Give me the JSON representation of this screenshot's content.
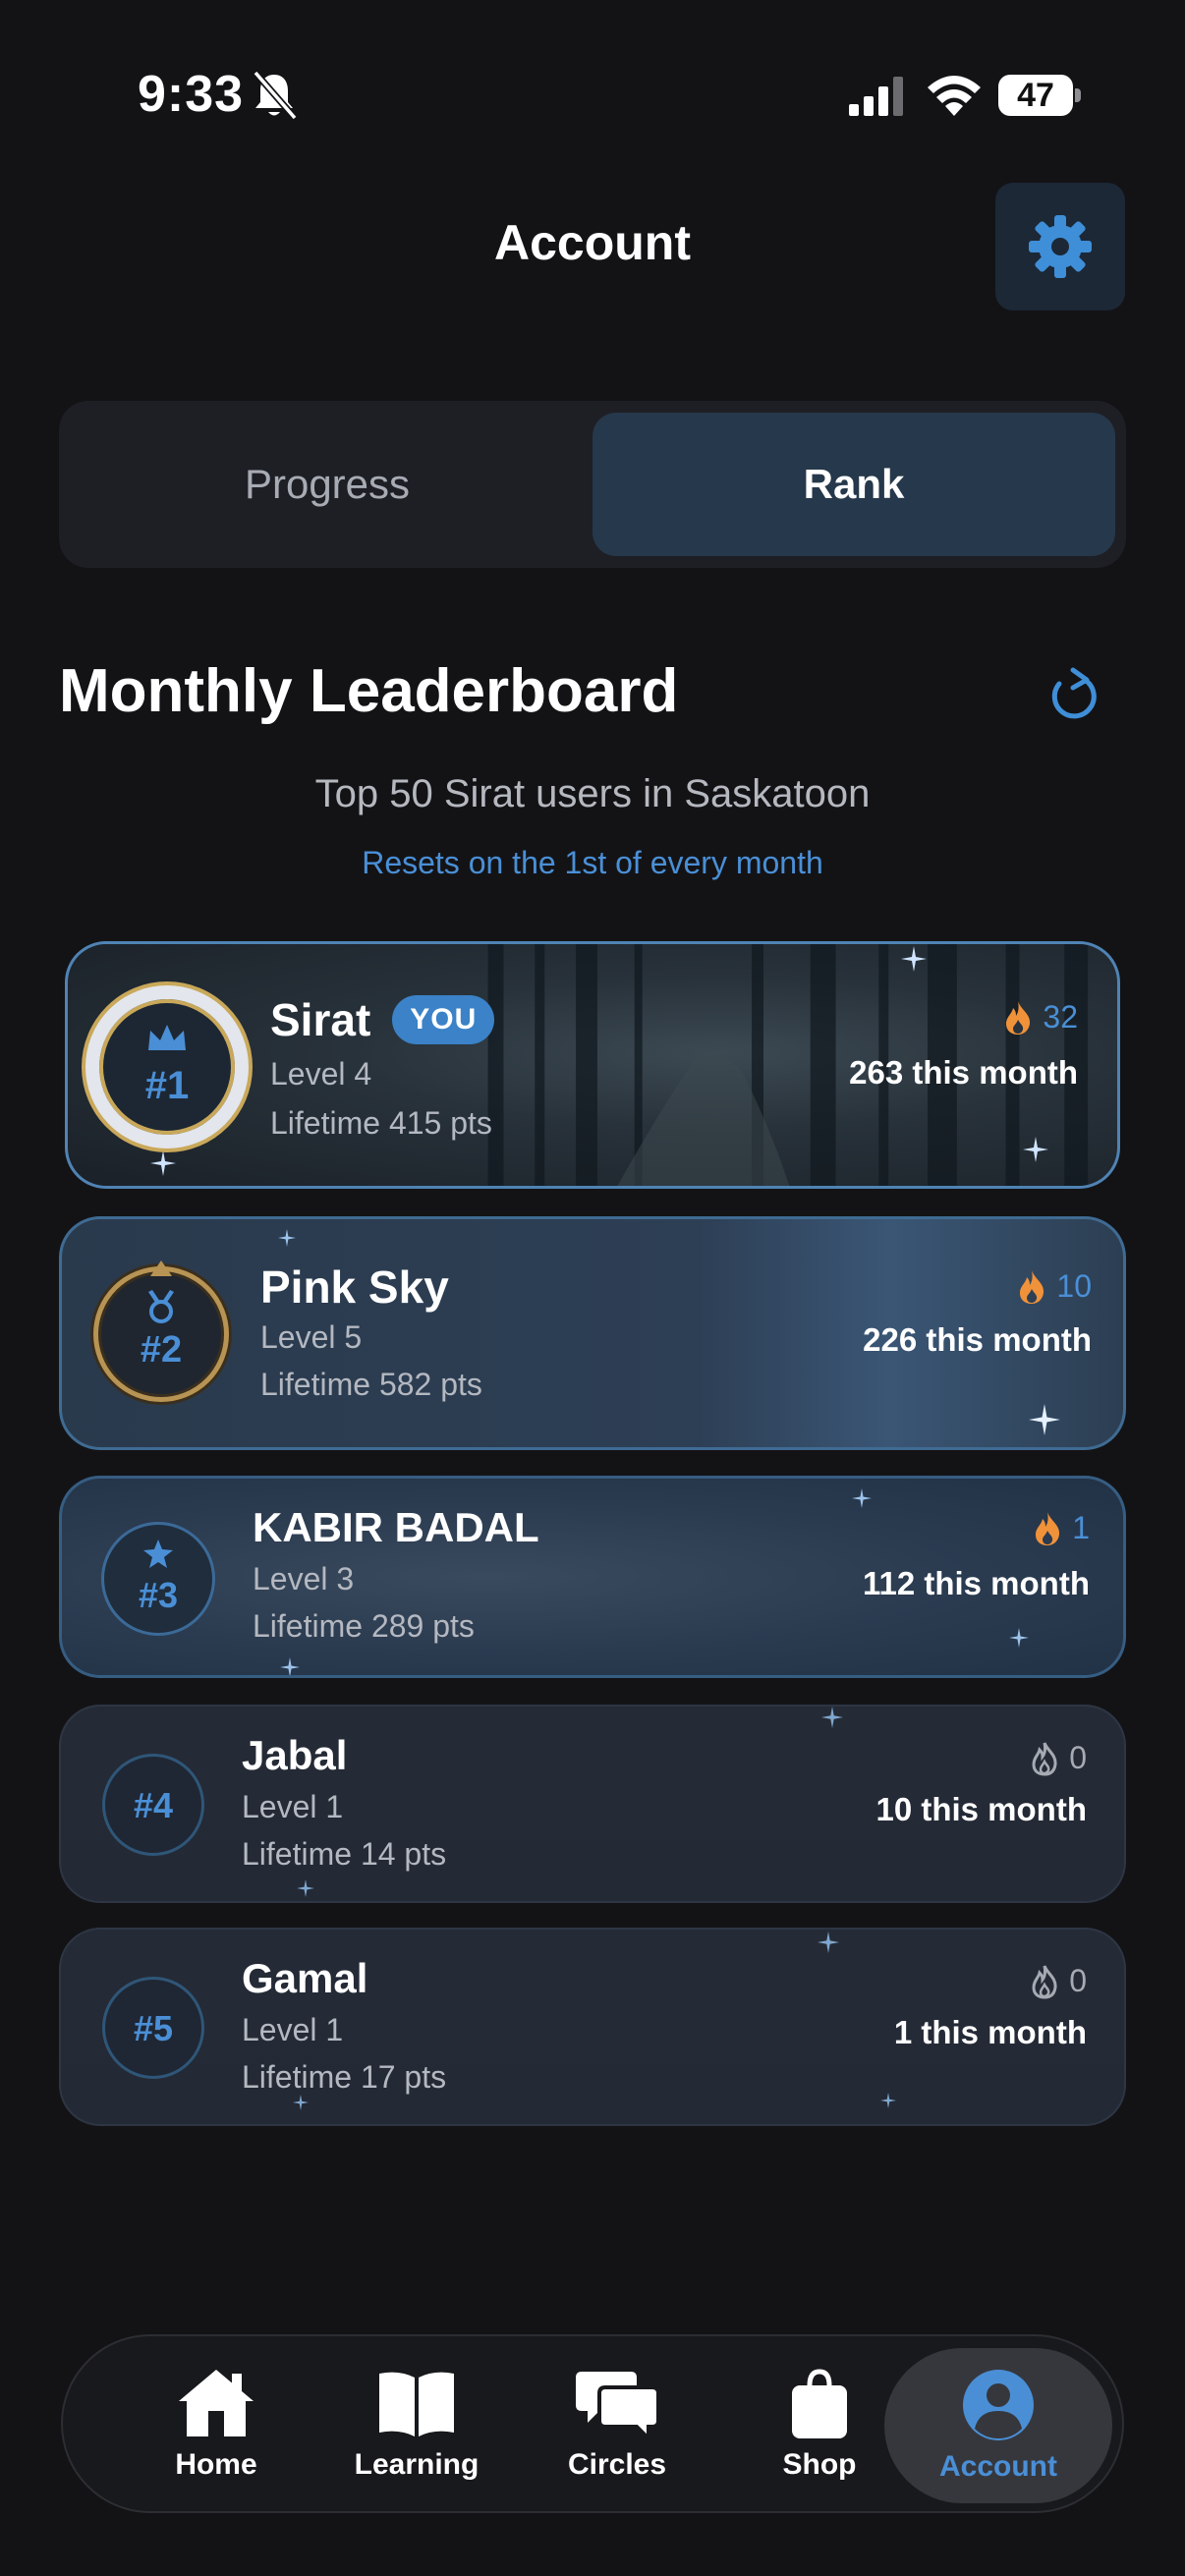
{
  "status_bar": {
    "time": "9:33",
    "battery": "47"
  },
  "header": {
    "title": "Account"
  },
  "tabs": [
    {
      "label": "Progress",
      "active": false
    },
    {
      "label": "Rank",
      "active": true
    }
  ],
  "leaderboard": {
    "title": "Monthly Leaderboard",
    "subtitle": "Top 50 Sirat users in Saskatoon",
    "reset_note": "Resets on the 1st of every month",
    "entries": [
      {
        "rank": "#1",
        "name": "Sirat",
        "you": "YOU",
        "level": "Level 4",
        "lifetime": "Lifetime 415 pts",
        "streak": "32",
        "streak_active": true,
        "month": "263 this month"
      },
      {
        "rank": "#2",
        "name": "Pink Sky",
        "level": "Level 5",
        "lifetime": "Lifetime 582 pts",
        "streak": "10",
        "streak_active": true,
        "month": "226 this month"
      },
      {
        "rank": "#3",
        "name": "KABIR BADAL",
        "level": "Level 3",
        "lifetime": "Lifetime 289 pts",
        "streak": "1",
        "streak_active": true,
        "month": "112 this month"
      },
      {
        "rank": "#4",
        "name": "Jabal",
        "level": "Level 1",
        "lifetime": "Lifetime 14 pts",
        "streak": "0",
        "streak_active": false,
        "month": "10 this month"
      },
      {
        "rank": "#5",
        "name": "Gamal",
        "level": "Level 1",
        "lifetime": "Lifetime 17 pts",
        "streak": "0",
        "streak_active": false,
        "month": "1 this month"
      }
    ]
  },
  "bottom_nav": [
    {
      "label": "Home",
      "icon": "home-icon"
    },
    {
      "label": "Learning",
      "icon": "book-icon"
    },
    {
      "label": "Circles",
      "icon": "chat-bubbles-icon"
    },
    {
      "label": "Shop",
      "icon": "shopping-bag-icon"
    },
    {
      "label": "Account",
      "icon": "person-circle-icon",
      "active": true
    }
  ],
  "colors": {
    "background": "#131316",
    "accent": "#4a8fd6",
    "streak_fire": "#f0923a",
    "active_tab": "#26384b"
  }
}
